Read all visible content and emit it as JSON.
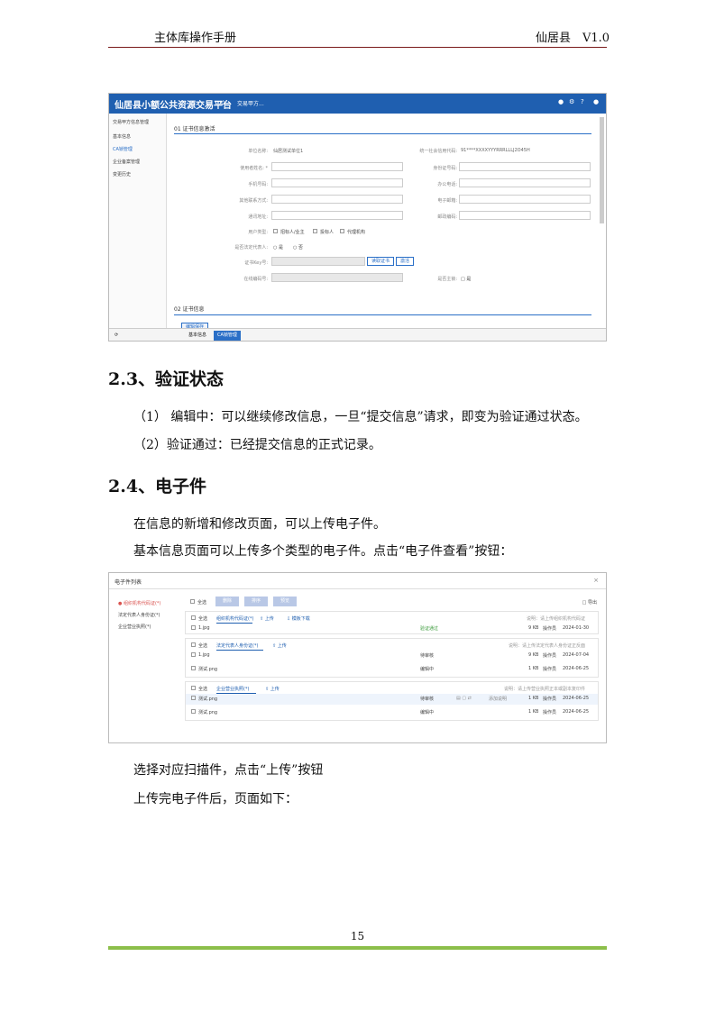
{
  "header": {
    "left": "主体库操作手册",
    "right": "仙居县　V1.0"
  },
  "shot1": {
    "app_title": "仙居县小额公共资源交易平台",
    "breadcrumb": "交易甲方...",
    "sidebar_title": "交易甲方信息管理",
    "sidebar_items": [
      "基本信息",
      "CA锁管理",
      "企业备案管理",
      "变更历史"
    ],
    "section1": "01 证书信息激活",
    "section2": "02 证书信息",
    "labels": {
      "unit_name": "单位名称:",
      "credit_code": "统一社会信用代码:",
      "user_name": "使用者姓名: *",
      "id_no": "身份证号码:",
      "mobile": "手机号码:",
      "office_phone": "办公电话:",
      "contact": "其他联系方式:",
      "email": "电子邮箱:",
      "address": "通讯地址:",
      "postcode": "邮政编码:",
      "user_type": "用户类型:",
      "is_legal": "是否法定代表人:",
      "ukey": "证书Key号:",
      "biz": "在线编码号:",
      "default": "是否主锁:"
    },
    "values": {
      "unit_name": "仙居测试单位1",
      "credit_code": "91****XXXXYYYRRRLLLJ2O45H"
    },
    "user_types": [
      "招标人/业主",
      "投标人",
      "代理机构"
    ],
    "yes": "是",
    "no": "否",
    "read_button": "读取证书",
    "activate_button": "激活",
    "edit_button": "编辑保存",
    "tabs": [
      "基本信息",
      "CA锁管理"
    ]
  },
  "section_2_3": {
    "heading": "2.3、验证状态",
    "p1": "（1） 编辑中：可以继续修改信息，一旦“提交信息”请求，即变为验证通过状态。",
    "p2": "（2）验证通过：已经提交信息的正式记录。"
  },
  "section_2_4": {
    "heading": "2.4、电子件",
    "p1": "在信息的新增和修改页面，可以上传电子件。",
    "p2": "基本信息页面可以上传多个类型的电子件。点击“电子件查看”按钮："
  },
  "shot2": {
    "title": "电子件列表",
    "close": "×",
    "side": [
      "● 组织机构代码证(*)",
      "法定代表人身份证(*)",
      "企业营业执照(*)"
    ],
    "toolbar": [
      "删除",
      "排序",
      "预览"
    ],
    "select_all": "全选",
    "top_right": "□ 导出",
    "groups": [
      {
        "name": "组织机构代码证(*)",
        "upload": "上传",
        "download": "模板下载",
        "note": "说明：请上传组织机构代码证",
        "rows": [
          {
            "name": "1.jpg",
            "status": "验证通过",
            "size": "9 KB",
            "user": "操作员",
            "date": "2024-01-30"
          }
        ]
      },
      {
        "name": "法定代表人身份证(*)",
        "upload": "上传",
        "note": "说明：请上传法定代表人身份证正反面",
        "rows": [
          {
            "name": "1.jpg",
            "status": "待审核",
            "size": "9 KB",
            "user": "操作员",
            "date": "2024-07-04"
          },
          {
            "name": "测试.png",
            "status": "编辑中",
            "size": "1 KB",
            "user": "操作员",
            "date": "2024-06-25"
          }
        ]
      },
      {
        "name": "企业营业执照(*)",
        "upload": "上传",
        "note": "说明：请上传营业执照正本或副本复印件",
        "rows": [
          {
            "name": "测试.png",
            "status": "待审核",
            "size": "1 KB",
            "user": "操作员",
            "date": "2024-06-25",
            "action": "添加说明"
          },
          {
            "name": "测试.png",
            "status": "编辑中",
            "size": "1 KB",
            "user": "操作员",
            "date": "2024-06-25"
          }
        ]
      }
    ]
  },
  "after_text": {
    "p1": "选择对应扫描件，点击“上传”按钮",
    "p2": "上传完电子件后，页面如下："
  },
  "page_number": "15"
}
